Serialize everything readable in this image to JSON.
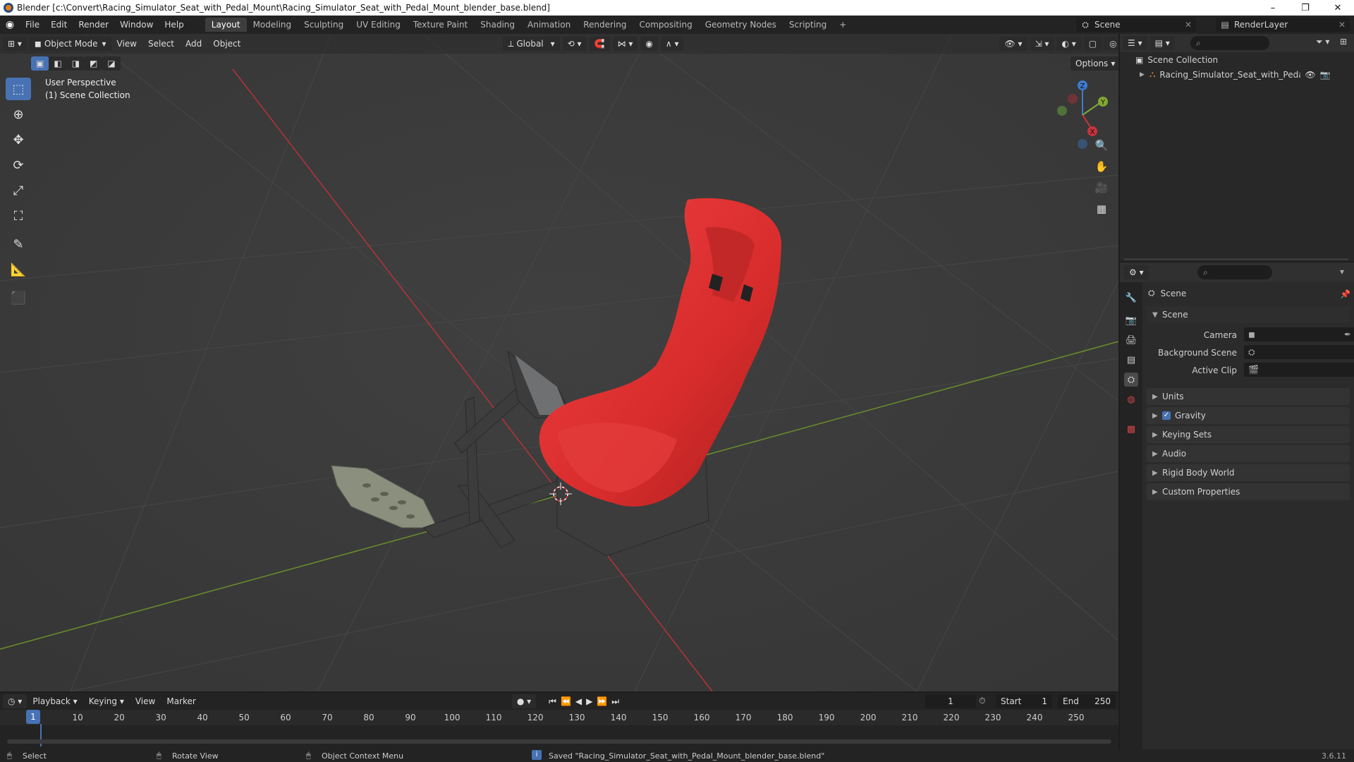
{
  "window": {
    "title": "Blender [c:\\Convert\\Racing_Simulator_Seat_with_Pedal_Mount\\Racing_Simulator_Seat_with_Pedal_Mount_blender_base.blend]",
    "minimize": "–",
    "maximize": "❐",
    "close": "✕"
  },
  "menubar": {
    "items": [
      "File",
      "Edit",
      "Render",
      "Window",
      "Help"
    ],
    "workspaces": [
      "Layout",
      "Modeling",
      "Sculpting",
      "UV Editing",
      "Texture Paint",
      "Shading",
      "Animation",
      "Rendering",
      "Compositing",
      "Geometry Nodes",
      "Scripting"
    ],
    "active_workspace": "Layout",
    "add_workspace": "+",
    "scene_name": "Scene",
    "view_layer": "RenderLayer"
  },
  "viewport": {
    "mode": "Object Mode",
    "menus": [
      "View",
      "Select",
      "Add",
      "Object"
    ],
    "orientation": "Global",
    "options_label": "Options",
    "overlay_line1": "User Perspective",
    "overlay_line2": "(1) Scene Collection",
    "gizmo": {
      "x": "X",
      "y": "Y",
      "z": "Z"
    }
  },
  "outliner": {
    "root": "Scene Collection",
    "item": "Racing_Simulator_Seat_with_Pedal_Mou"
  },
  "properties": {
    "context": "Scene",
    "scene_panel": "Scene",
    "camera_label": "Camera",
    "background_scene_label": "Background Scene",
    "active_clip_label": "Active Clip",
    "sections": [
      "Units",
      "Gravity",
      "Keying Sets",
      "Audio",
      "Rigid Body World",
      "Custom Properties"
    ],
    "gravity_checked": true
  },
  "timeline": {
    "menus": [
      "Playback",
      "Keying",
      "View",
      "Marker"
    ],
    "current_frame": "1",
    "start_label": "Start",
    "start": "1",
    "end_label": "End",
    "end": "250",
    "ruler": [
      "1",
      "10",
      "20",
      "30",
      "40",
      "50",
      "60",
      "70",
      "80",
      "90",
      "100",
      "110",
      "120",
      "130",
      "140",
      "150",
      "160",
      "170",
      "180",
      "190",
      "200",
      "210",
      "220",
      "230",
      "240",
      "250"
    ]
  },
  "statusbar": {
    "select": "Select",
    "rotate": "Rotate View",
    "context_menu": "Object Context Menu",
    "message": "Saved \"Racing_Simulator_Seat_with_Pedal_Mount_blender_base.blend\"",
    "version": "3.6.11"
  },
  "colors": {
    "accent": "#4772b3",
    "seat_red": "#e03131",
    "x_axis": "#c9333c",
    "y_axis": "#7fa832",
    "z_axis": "#3f7bd0"
  }
}
